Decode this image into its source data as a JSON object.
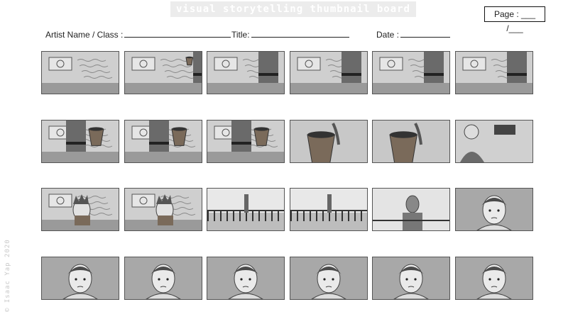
{
  "header": {
    "title": "visual storytelling thumbnail board",
    "page_label": "Page : ___ /___",
    "artist_label": "Artist Name / Class :",
    "title_label": "Title:",
    "date_label": "Date :"
  },
  "watermark": "© Isaac Yap 2020",
  "frames": [
    {
      "scene": "wall"
    },
    {
      "scene": "wall-cup"
    },
    {
      "scene": "wall-person"
    },
    {
      "scene": "wall-person"
    },
    {
      "scene": "wall-person"
    },
    {
      "scene": "wall-person"
    },
    {
      "scene": "wall-cup-hand"
    },
    {
      "scene": "wall-cup-hand"
    },
    {
      "scene": "wall-cup-hand"
    },
    {
      "scene": "cup-closeup"
    },
    {
      "scene": "cup-closeup"
    },
    {
      "scene": "desk-person"
    },
    {
      "scene": "face-wall"
    },
    {
      "scene": "face-wall"
    },
    {
      "scene": "street"
    },
    {
      "scene": "street"
    },
    {
      "scene": "robot"
    },
    {
      "scene": "face"
    },
    {
      "scene": "face"
    },
    {
      "scene": "face"
    },
    {
      "scene": "face"
    },
    {
      "scene": "face"
    },
    {
      "scene": "face"
    },
    {
      "scene": "face"
    }
  ],
  "colors": {
    "frame_bg": "#bdbdbd",
    "wall": "#cfcfcf",
    "floor": "#9a9a9a",
    "dark": "#4a4a4a"
  }
}
